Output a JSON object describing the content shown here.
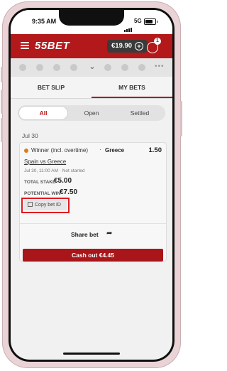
{
  "status_bar": {
    "time": "9:35 AM",
    "network": "5G"
  },
  "header": {
    "logo": "55BET",
    "balance": "€19.90",
    "balance_add_symbol": "+",
    "notification_count": "1"
  },
  "sports_strip": {
    "more": "•••"
  },
  "tabs": [
    {
      "label": "BET SLIP",
      "active": false
    },
    {
      "label": "MY BETS",
      "active": true
    }
  ],
  "filters": [
    {
      "label": "All",
      "active": true
    },
    {
      "label": "Open",
      "active": false
    },
    {
      "label": "Settled",
      "active": false
    }
  ],
  "date_group": "Jul 30",
  "bet": {
    "market": "Winner (incl. overtime)",
    "separator": "·",
    "selection": "Greece",
    "odds": "1.50",
    "event": "Spain vs Greece",
    "meta": "Jul 30, 11:00 AM  ·  Not started",
    "total_stake_label": "TOTAL STAKE",
    "total_stake": "€5.00",
    "potential_win_label": "POTENTIAL WIN",
    "potential_win": "€7.50",
    "copy_bet_id": "Copy bet ID",
    "share_bet": "Share bet",
    "share_icon": "➦",
    "cash_out": "Cash out  €4.45"
  },
  "colors": {
    "brand_red": "#b3181a",
    "highlight_red": "#e11a22",
    "cashout_red": "#a8161a"
  }
}
